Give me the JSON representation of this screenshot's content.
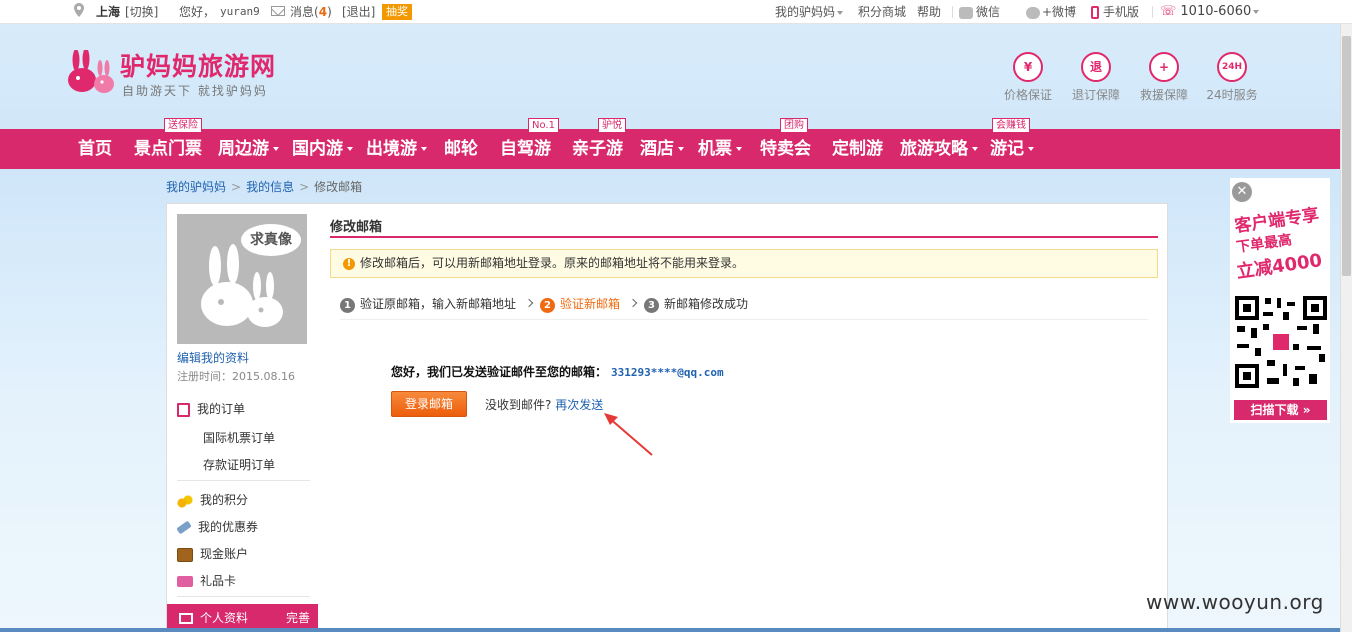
{
  "topbar": {
    "city": "上海",
    "switch": "[切换]",
    "greeting": "您好，",
    "username": "yuran9",
    "messages_label": "消息",
    "messages_count": "4",
    "logout": "[退出]",
    "lottery": "抽奖",
    "my_lvmama": "我的驴妈妈",
    "points_mall": "积分商城",
    "help": "帮助",
    "wechat": "微信",
    "weibo": "+微博",
    "mobile": "手机版",
    "phone": "1010-6060"
  },
  "header": {
    "logo_text": "驴妈妈旅游网",
    "slogan": "自助游天下 就找驴妈妈",
    "guarantees": [
      {
        "icon_text": "¥",
        "label": "价格保证"
      },
      {
        "icon_text": "退",
        "label": "退订保障"
      },
      {
        "icon_text": "+",
        "label": "救援保障"
      },
      {
        "icon_text": "24H",
        "label": "24时服务"
      }
    ]
  },
  "nav": {
    "items": [
      "首页",
      "景点门票",
      "周边游",
      "国内游",
      "出境游",
      "邮轮",
      "自驾游",
      "亲子游",
      "酒店",
      "机票",
      "特卖会",
      "定制游",
      "旅游攻略",
      "游记"
    ],
    "tags": [
      "送保险",
      "No.1",
      "驴悦",
      "团购",
      "会赚钱"
    ]
  },
  "breadcrumb": {
    "level1": "我的驴妈妈",
    "level2": "我的信息",
    "current": "修改邮箱"
  },
  "sidebar": {
    "avatar_text": "求真像",
    "edit_profile": "编辑我的资料",
    "reg_time": "注册时间：2015.08.16",
    "my_orders": "我的订单",
    "intl_flight_orders": "国际机票订单",
    "deposit_orders": "存款证明订单",
    "my_points": "我的积分",
    "my_coupons": "我的优惠券",
    "cash_account": "现金账户",
    "gift_card": "礼品卡",
    "personal_info": "个人资料",
    "personal_info_status": "完善"
  },
  "main": {
    "title": "修改邮箱",
    "notice": "修改邮箱后，可以用新邮箱地址登录。原来的邮箱地址将不能用来登录。",
    "steps": [
      {
        "num": "1",
        "label": "验证原邮箱，输入新邮箱地址"
      },
      {
        "num": "2",
        "label": "验证新邮箱"
      },
      {
        "num": "3",
        "label": "新邮箱修改成功"
      }
    ],
    "sent_message": "您好，我们已发送验证邮件至您的邮箱：",
    "email": "331293****@qq.com",
    "login_button": "登录邮箱",
    "not_received": "没收到邮件?",
    "resend": "再次发送"
  },
  "promo": {
    "line1": "客户端专享",
    "line2": "下单最高",
    "line3": "立减4000",
    "download": "扫描下载"
  },
  "watermark": "www.wooyun.org",
  "colors": {
    "brand_pink": "#d8296c",
    "accent_orange": "#f06a0f",
    "link_blue": "#2062b0"
  }
}
